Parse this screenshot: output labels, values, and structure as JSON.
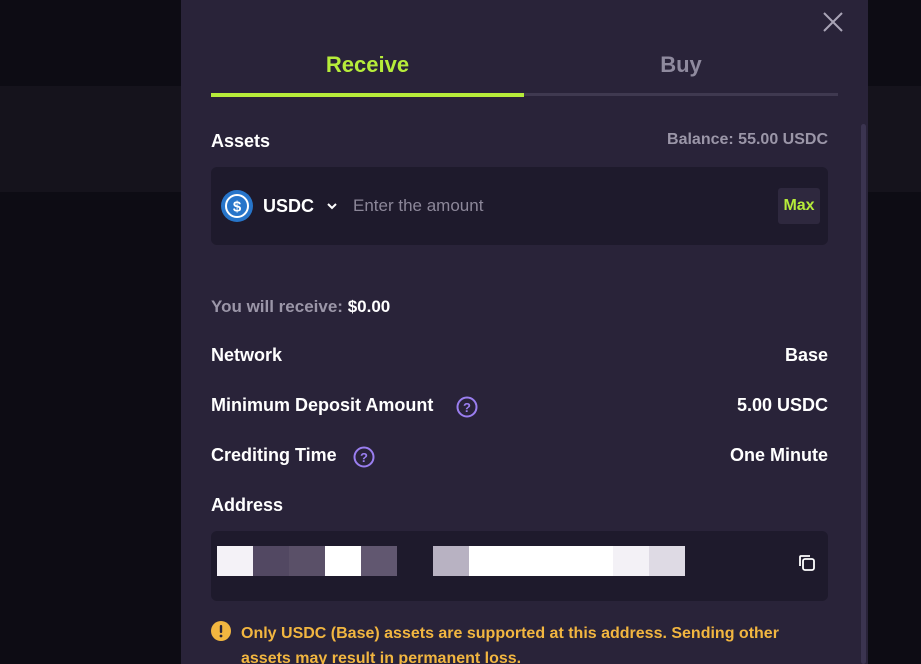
{
  "tabs": [
    {
      "label": "Receive",
      "active": true
    },
    {
      "label": "Buy",
      "active": false
    }
  ],
  "assets": {
    "title": "Assets",
    "balance": "Balance: 55.00 USDC",
    "selected_coin": "USDC",
    "coin_icon": "usdc-dollar-icon",
    "amount_placeholder": "Enter the amount",
    "max_label": "Max"
  },
  "receive": {
    "prefix": "You will receive:",
    "amount": "$0.00"
  },
  "details": {
    "network_label": "Network",
    "network_value": "Base",
    "min_deposit_label": "Minimum Deposit Amount",
    "min_deposit_value": "5.00 USDC",
    "crediting_label": "Crediting Time",
    "crediting_value": "One Minute"
  },
  "address": {
    "title": "Address"
  },
  "warning": {
    "text": "Only USDC (Base) assets are supported at this address. Sending other assets may result in permanent loss."
  },
  "colors": {
    "accent": "#b6ec3a",
    "modal_bg": "#292339",
    "input_bg": "#1e1a2c",
    "warning": "#f2b640",
    "help": "#9a7ef0"
  }
}
